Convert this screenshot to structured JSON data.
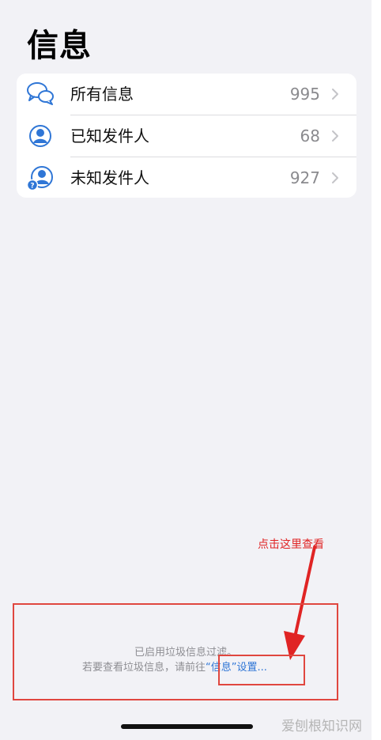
{
  "header": {
    "title": "信息"
  },
  "rows": [
    {
      "label": "所有信息",
      "count": "995",
      "icon": "chat-bubbles-icon"
    },
    {
      "label": "已知发件人",
      "count": "68",
      "icon": "person-circle-icon"
    },
    {
      "label": "未知发件人",
      "count": "927",
      "icon": "person-question-icon"
    }
  ],
  "footer": {
    "line1": "已启用垃圾信息过滤。",
    "line2_prefix": "若要查看垃圾信息，请前往",
    "link_text": "“信息”设置..."
  },
  "annotation": {
    "text": "点击这里查看"
  },
  "watermark": {
    "text": "爱刨根知识网"
  },
  "colors": {
    "accent": "#2f76d6",
    "annotation": "#e0473f",
    "background": "#f2f2f6"
  }
}
